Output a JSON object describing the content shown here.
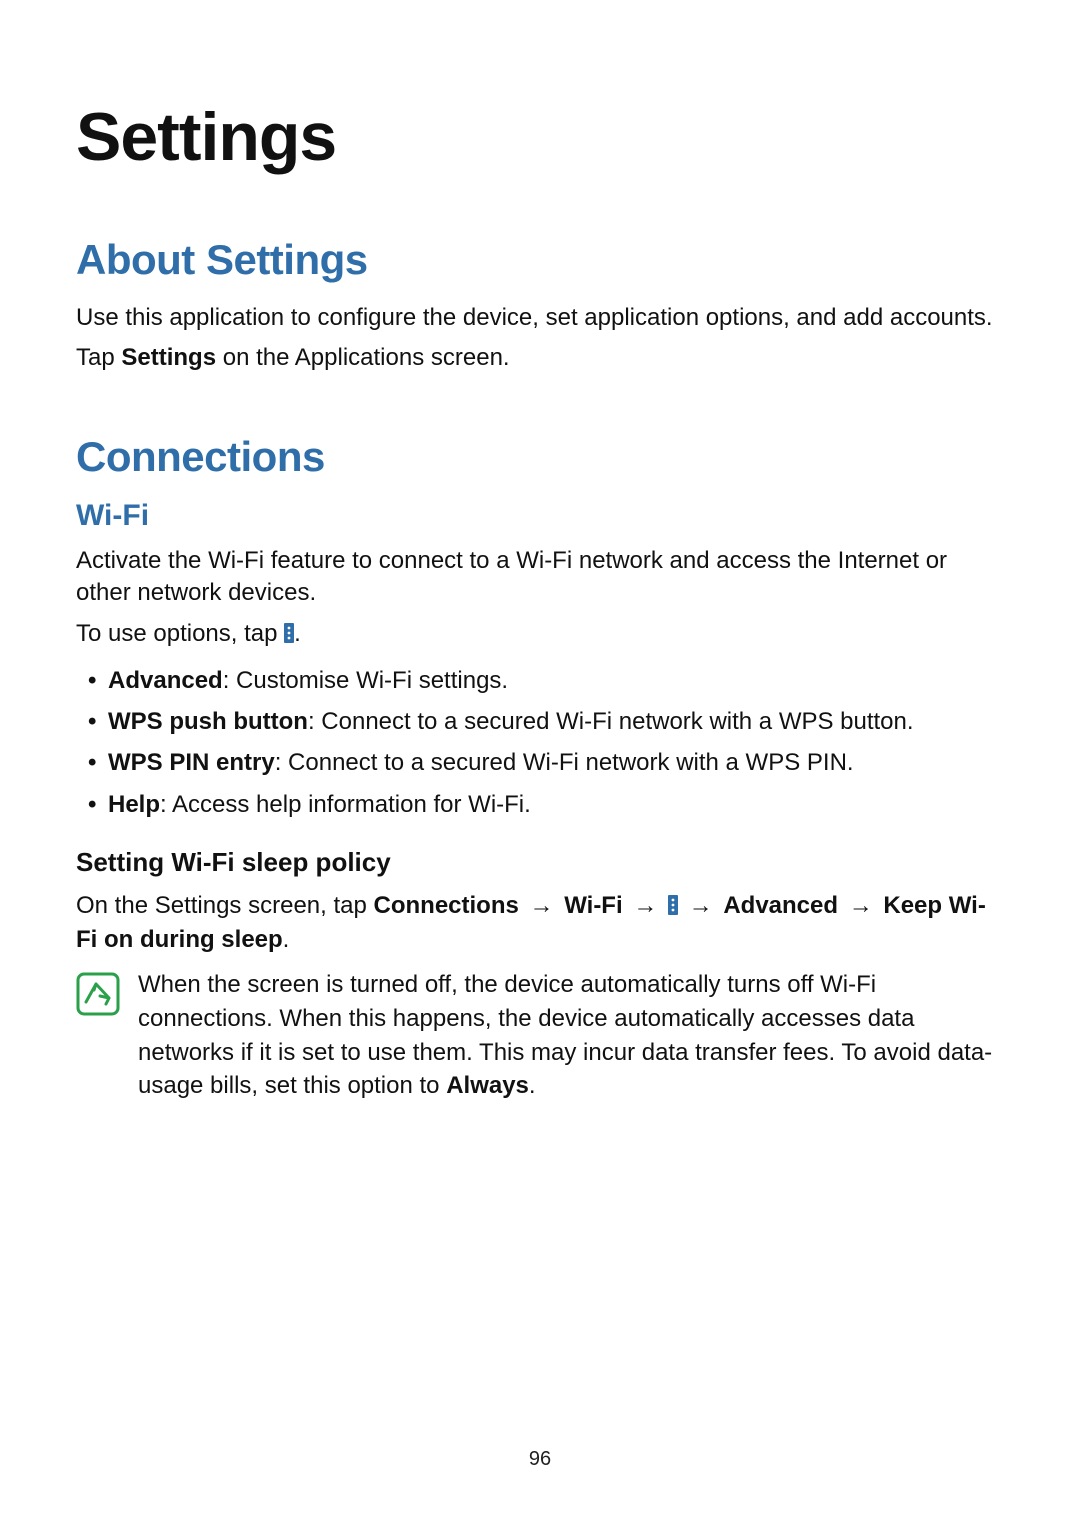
{
  "page_number": "96",
  "title": "Settings",
  "about": {
    "heading": "About Settings",
    "p1": "Use this application to configure the device, set application options, and add accounts.",
    "p2_pre": "Tap ",
    "p2_bold": "Settings",
    "p2_post": " on the Applications screen."
  },
  "connections": {
    "heading": "Connections",
    "wifi": {
      "heading": "Wi-Fi",
      "intro": "Activate the Wi-Fi feature to connect to a Wi-Fi network and access the Internet or other network devices.",
      "options_pre": "To use options, tap ",
      "options_post": ".",
      "items": [
        {
          "bold": "Advanced",
          "rest": ": Customise Wi-Fi settings."
        },
        {
          "bold": "WPS push button",
          "rest": ": Connect to a secured Wi-Fi network with a WPS button."
        },
        {
          "bold": "WPS PIN entry",
          "rest": ": Connect to a secured Wi-Fi network with a WPS PIN."
        },
        {
          "bold": "Help",
          "rest": ": Access help information for Wi-Fi."
        }
      ],
      "sleep_policy": {
        "heading": "Setting Wi-Fi sleep policy",
        "path_pre": "On the Settings screen, tap ",
        "path_b1": "Connections",
        "arrow": "→",
        "path_b2": "Wi-Fi",
        "path_b3": "Advanced",
        "path_b4": "Keep Wi-Fi on during sleep",
        "path_end": ".",
        "note_body": "When the screen is turned off, the device automatically turns off Wi-Fi connections. When this happens, the device automatically accesses data networks if it is set to use them. This may incur data transfer fees. To avoid data-usage bills, set this option to ",
        "note_bold": "Always",
        "note_end": "."
      }
    }
  },
  "icons": {
    "more": "more-options-icon",
    "note": "note-icon"
  }
}
